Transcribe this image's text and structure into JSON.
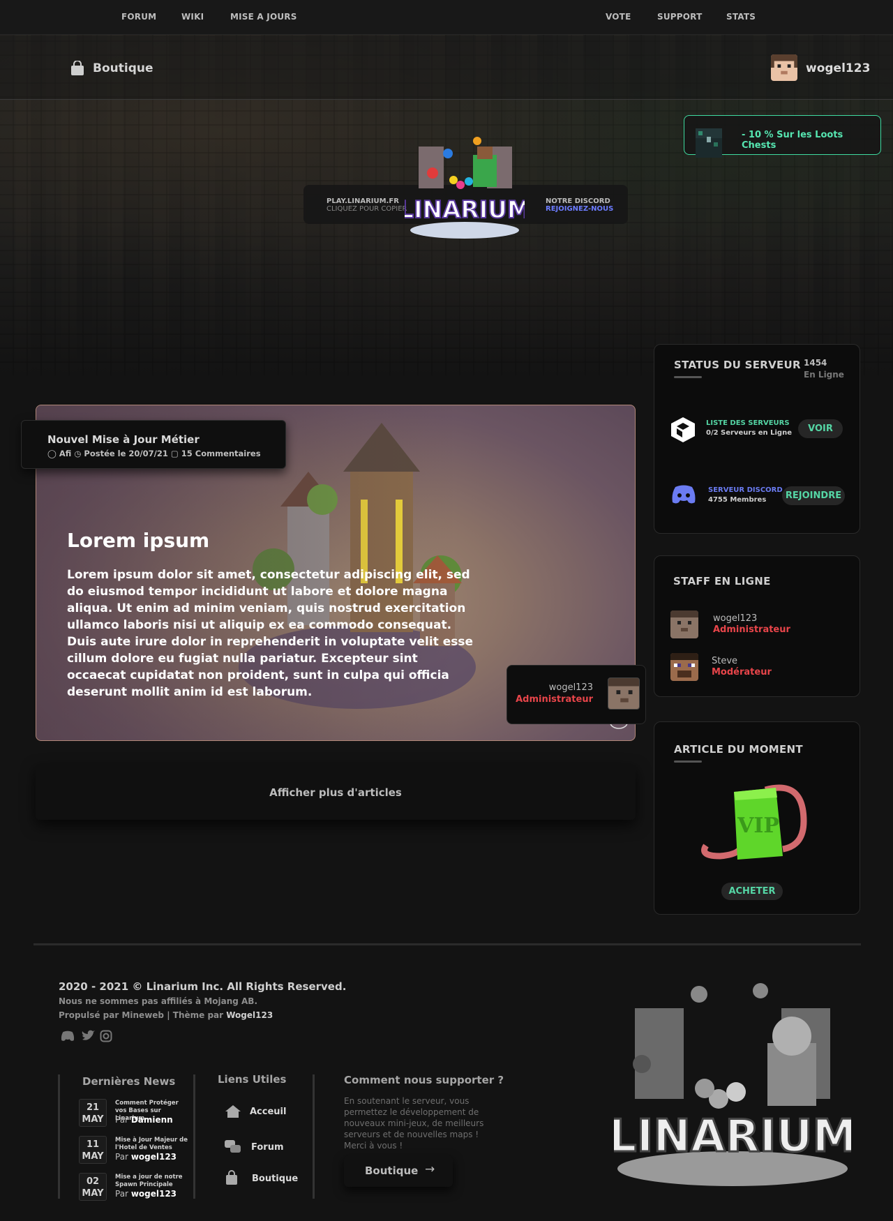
{
  "topnav": {
    "left": [
      "FORUM",
      "WIKI",
      "MISE A JOURS"
    ],
    "right": [
      "VOTE",
      "SUPPORT",
      "STATS"
    ]
  },
  "header": {
    "shop_label": "Boutique",
    "username": "wogel123"
  },
  "promo": {
    "text": "- 10 % Sur les Loots Chests",
    "accent": "#3fdca1"
  },
  "serverbar": {
    "ip": "PLAY.LINARIUM.FR",
    "ip_hint": "CLIQUEZ POUR COPIER",
    "discord": "NOTRE DISCORD",
    "discord_hint": "REJOIGNEZ-NOUS"
  },
  "logo_text": "LINARIUM",
  "status": {
    "title": "STATUS DU SERVEUR",
    "online_count": "1454",
    "online_label": "En Ligne",
    "servers_label": "LISTE DES SERVEURS",
    "servers_sub": "0/2 Serveurs en Ligne",
    "servers_btn": "VOIR",
    "discord_label": "SERVEUR DISCORD",
    "discord_sub": "4755 Membres",
    "discord_btn": "REJOINDRE"
  },
  "staff": {
    "title": "STAFF EN LIGNE",
    "members": [
      {
        "name": "wogel123",
        "role": "Administrateur"
      },
      {
        "name": "Steve",
        "role": "Modérateur"
      }
    ],
    "role_color": "#e8454a"
  },
  "featured": {
    "title": "ARTICLE DU MOMENT",
    "badge": "VIP",
    "btn": "ACHETER"
  },
  "article": {
    "title": "Nouvel Mise à Jour Métier",
    "author": "Afi",
    "posted": "Postée le 20/07/21",
    "comments": "15 Commentaires",
    "heading": "Lorem ipsum",
    "body": "Lorem ipsum dolor sit amet, consectetur adipiscing elit, sed do eiusmod tempor incididunt ut labore et dolore magna aliqua. Ut enim ad minim veniam, quis nostrud exercitation ullamco laboris nisi ut aliquip ex ea commodo consequat. Duis aute irure dolor in reprehenderit in voluptate velit esse cillum dolore eu fugiat nulla pariatur. Excepteur sint occaecat cupidatat non proident, sunt in culpa qui officia deserunt mollit anim id est laborum.",
    "author_card": {
      "name": "wogel123",
      "role": "Administrateur"
    }
  },
  "more_articles": "Afficher plus d'articles",
  "footer": {
    "copyright": "2020 - 2021 © Linarium Inc. All Rights Reserved.",
    "disclaimer": "Nous ne sommes pas affiliés à Mojang AB.",
    "powered_prefix": "Propulsé par ",
    "powered_cms": "Mineweb",
    "theme_prefix": " | Thème par ",
    "theme_author": "Wogel123",
    "news_title": "Dernières News",
    "news": [
      {
        "day": "21",
        "month": "MAY",
        "title": "Comment Protéger vos Bases sur Linarium...",
        "by": "Par",
        "author": "Damienn"
      },
      {
        "day": "11",
        "month": "MAY",
        "title": "Mise à Jour Majeur de l'Hotel de Ventes",
        "by": "Par",
        "author": "wogel123"
      },
      {
        "day": "02",
        "month": "MAY",
        "title": "Mise a jour de notre Spawn Principale",
        "by": "Par",
        "author": "wogel123"
      }
    ],
    "links_title": "Liens Utiles",
    "links": [
      "Acceuil",
      "Forum",
      "Boutique"
    ],
    "support_title": "Comment nous supporter ?",
    "support_text": "En soutenant le serveur, vous permettez le développement de nouveaux mini-jeux, de meilleurs serveurs et de nouvelles maps ! Merci à vous !",
    "support_btn": "Boutique"
  }
}
